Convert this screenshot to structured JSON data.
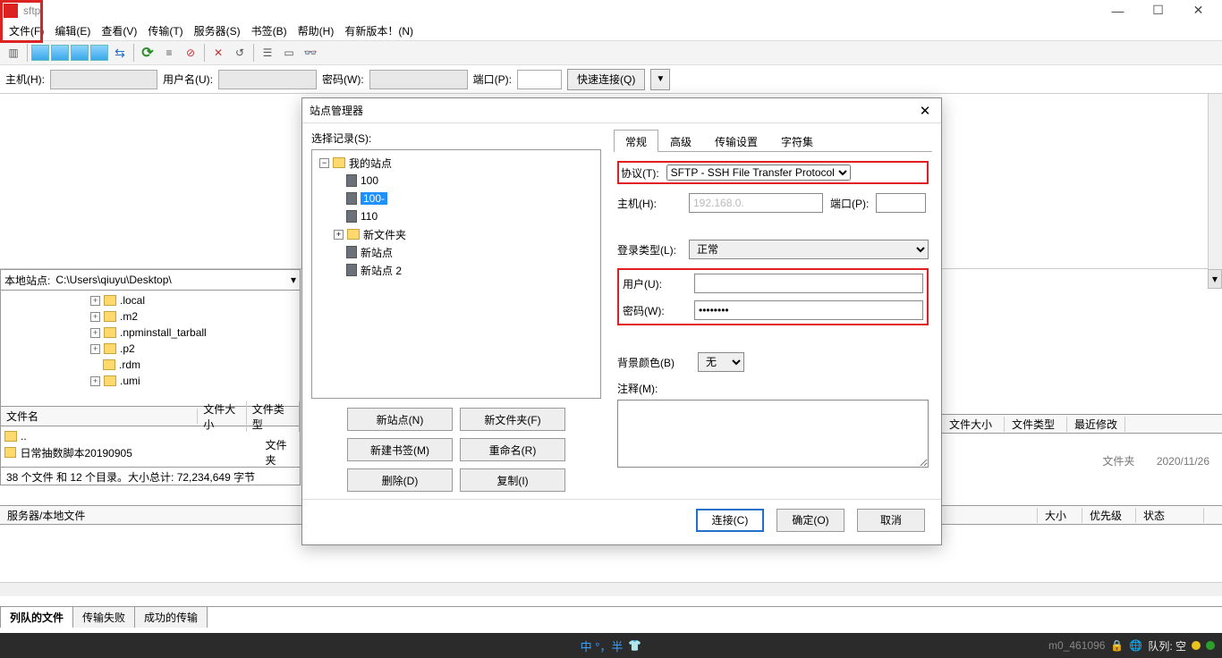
{
  "title": "sftp",
  "menubar": [
    "文件(F)",
    "编辑(E)",
    "查看(V)",
    "传输(T)",
    "服务器(S)",
    "书签(B)",
    "帮助(H)",
    "有新版本！(N)"
  ],
  "quick": {
    "host_label": "主机(H):",
    "user_label": "用户名(U):",
    "pass_label": "密码(W):",
    "port_label": "端口(P):",
    "connect": "快速连接(Q)"
  },
  "local": {
    "label": "本地站点:",
    "path": "C:\\Users\\qiuyu\\Desktop\\",
    "tree": [
      ".local",
      ".m2",
      ".npminstall_tarball",
      ".p2",
      ".rdm",
      ".umi"
    ],
    "cols": {
      "name": "文件名",
      "size": "文件大小",
      "type": "文件类型"
    },
    "rows": [
      {
        "n": "..",
        "t": ""
      },
      {
        "n": "日常抽数脚本20190905",
        "t": "文件夹"
      }
    ],
    "status": "38 个文件 和 12 个目录。大小总计: 72,234,649 字节"
  },
  "remote_cols": {
    "size": "文件大小",
    "type": "文件类型",
    "mod": "最近修改"
  },
  "remote_faded": {
    "type": "文件夹",
    "date": "2020/11/26"
  },
  "transfer_cols": {
    "file": "服务器/本地文件",
    "size": "大小",
    "prio": "优先级",
    "status": "状态"
  },
  "bottom_tabs": [
    "列队的文件",
    "传输失败",
    "成功的传输"
  ],
  "statusbar": {
    "ime": "中 °，半",
    "queue": "队列: 空",
    "wm": "m0_461096"
  },
  "dialog": {
    "title": "站点管理器",
    "select_label": "选择记录(S):",
    "tree": {
      "root": "我的站点",
      "items": [
        "100",
        "100-",
        "110"
      ],
      "folder": "新文件夹",
      "subs": [
        "新站点",
        "新站点 2"
      ]
    },
    "buttons": {
      "new_site": "新站点(N)",
      "new_folder": "新文件夹(F)",
      "new_bm": "新建书签(M)",
      "rename": "重命名(R)",
      "delete": "删除(D)",
      "copy": "复制(I)"
    },
    "tabs": [
      "常规",
      "高级",
      "传输设置",
      "字符集"
    ],
    "form": {
      "protocol_label": "协议(T):",
      "protocol_value": "SFTP - SSH File Transfer Protocol",
      "host_label": "主机(H):",
      "host_value": "192.168.0.",
      "port_label": "端口(P):",
      "login_type_label": "登录类型(L):",
      "login_type_value": "正常",
      "user_label": "用户(U):",
      "user_value": " ",
      "pass_label": "密码(W):",
      "pass_value": "••••••••",
      "bg_label": "背景颜色(B)",
      "bg_value": "无",
      "note_label": "注释(M):"
    },
    "footer": {
      "connect": "连接(C)",
      "ok": "确定(O)",
      "cancel": "取消"
    }
  }
}
